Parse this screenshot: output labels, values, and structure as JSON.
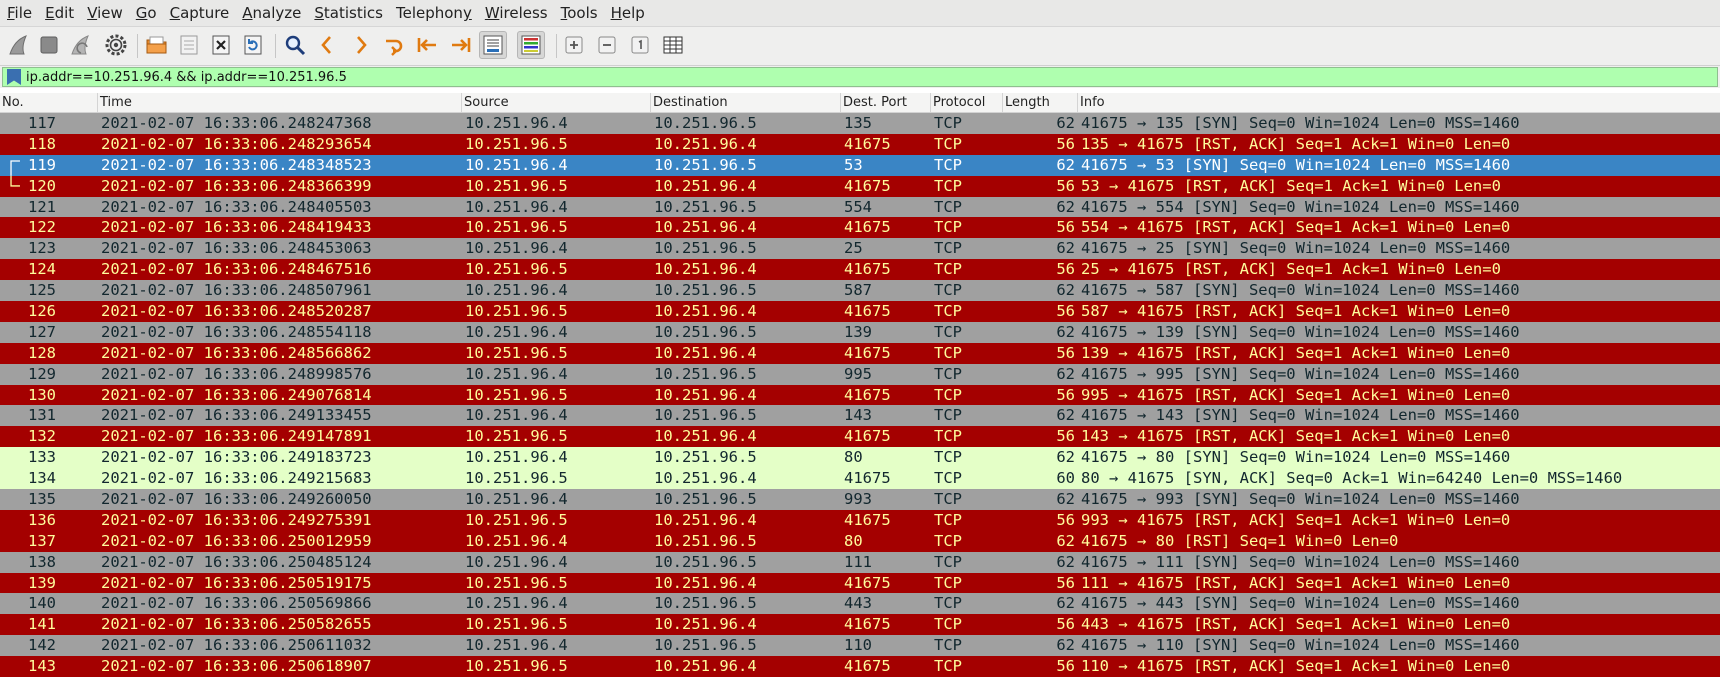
{
  "menu": {
    "items": [
      {
        "key": "F",
        "rest": "ile"
      },
      {
        "key": "E",
        "rest": "dit"
      },
      {
        "key": "V",
        "rest": "iew"
      },
      {
        "key": "G",
        "rest": "o"
      },
      {
        "key": "C",
        "rest": "apture"
      },
      {
        "key": "A",
        "rest": "nalyze"
      },
      {
        "key": "S",
        "rest": "tatistics"
      },
      {
        "key": "",
        "rest": "Telephon",
        "key2": "y"
      },
      {
        "key": "W",
        "rest": "ireless"
      },
      {
        "key": "T",
        "rest": "ools"
      },
      {
        "key": "H",
        "rest": "elp"
      }
    ]
  },
  "toolbar": {
    "icons": [
      "shark-fin-start-icon",
      "stop-square-icon",
      "shark-fin-restart-icon",
      "gear-options-icon",
      "open-folder-icon",
      "save-file-icon",
      "close-file-icon",
      "reload-icon",
      "search-magnifier-icon",
      "go-back-icon",
      "go-forward-icon",
      "go-to-packet-icon",
      "first-packet-icon",
      "last-packet-icon",
      "autoscroll-icon",
      "colorize-icon",
      "zoom-in-icon",
      "zoom-out-icon",
      "normal-size-icon",
      "resize-columns-icon"
    ]
  },
  "filter": {
    "value": "ip.addr==10.251.96.4 && ip.addr==10.251.96.5"
  },
  "columns": [
    "No.",
    "Time",
    "Source",
    "Destination",
    "Dest. Port",
    "Protocol",
    "Length",
    "Info"
  ],
  "colors": {
    "synfin_bg": "#a0a0a0",
    "rst_bg": "#a40000",
    "rst_fg": "#fffc9c",
    "selected_bg": "#3a85c5",
    "http_bg": "#e4ffc7",
    "filter_bg": "#afffaf"
  },
  "selected_row": 2,
  "packets": [
    {
      "no": "117",
      "time": "2021-02-07 16:33:06.248247368",
      "src": "10.251.96.4",
      "dst": "10.251.96.5",
      "port": "135",
      "proto": "TCP",
      "len": "62",
      "info": "41675 → 135 [SYN] Seq=0 Win=1024 Len=0 MSS=1460",
      "kind": "synfin"
    },
    {
      "no": "118",
      "time": "2021-02-07 16:33:06.248293654",
      "src": "10.251.96.5",
      "dst": "10.251.96.4",
      "port": "41675",
      "proto": "TCP",
      "len": "56",
      "info": "135 → 41675 [RST, ACK] Seq=1 Ack=1 Win=0 Len=0",
      "kind": "rst"
    },
    {
      "no": "119",
      "time": "2021-02-07 16:33:06.248348523",
      "src": "10.251.96.4",
      "dst": "10.251.96.5",
      "port": "53",
      "proto": "TCP",
      "len": "62",
      "info": "41675 → 53 [SYN] Seq=0 Win=1024 Len=0 MSS=1460",
      "kind": "sel"
    },
    {
      "no": "120",
      "time": "2021-02-07 16:33:06.248366399",
      "src": "10.251.96.5",
      "dst": "10.251.96.4",
      "port": "41675",
      "proto": "TCP",
      "len": "56",
      "info": "53 → 41675 [RST, ACK] Seq=1 Ack=1 Win=0 Len=0",
      "kind": "rst"
    },
    {
      "no": "121",
      "time": "2021-02-07 16:33:06.248405503",
      "src": "10.251.96.4",
      "dst": "10.251.96.5",
      "port": "554",
      "proto": "TCP",
      "len": "62",
      "info": "41675 → 554 [SYN] Seq=0 Win=1024 Len=0 MSS=1460",
      "kind": "synfin"
    },
    {
      "no": "122",
      "time": "2021-02-07 16:33:06.248419433",
      "src": "10.251.96.5",
      "dst": "10.251.96.4",
      "port": "41675",
      "proto": "TCP",
      "len": "56",
      "info": "554 → 41675 [RST, ACK] Seq=1 Ack=1 Win=0 Len=0",
      "kind": "rst"
    },
    {
      "no": "123",
      "time": "2021-02-07 16:33:06.248453063",
      "src": "10.251.96.4",
      "dst": "10.251.96.5",
      "port": "25",
      "proto": "TCP",
      "len": "62",
      "info": "41675 → 25 [SYN] Seq=0 Win=1024 Len=0 MSS=1460",
      "kind": "synfin"
    },
    {
      "no": "124",
      "time": "2021-02-07 16:33:06.248467516",
      "src": "10.251.96.5",
      "dst": "10.251.96.4",
      "port": "41675",
      "proto": "TCP",
      "len": "56",
      "info": "25 → 41675 [RST, ACK] Seq=1 Ack=1 Win=0 Len=0",
      "kind": "rst"
    },
    {
      "no": "125",
      "time": "2021-02-07 16:33:06.248507961",
      "src": "10.251.96.4",
      "dst": "10.251.96.5",
      "port": "587",
      "proto": "TCP",
      "len": "62",
      "info": "41675 → 587 [SYN] Seq=0 Win=1024 Len=0 MSS=1460",
      "kind": "synfin"
    },
    {
      "no": "126",
      "time": "2021-02-07 16:33:06.248520287",
      "src": "10.251.96.5",
      "dst": "10.251.96.4",
      "port": "41675",
      "proto": "TCP",
      "len": "56",
      "info": "587 → 41675 [RST, ACK] Seq=1 Ack=1 Win=0 Len=0",
      "kind": "rst"
    },
    {
      "no": "127",
      "time": "2021-02-07 16:33:06.248554118",
      "src": "10.251.96.4",
      "dst": "10.251.96.5",
      "port": "139",
      "proto": "TCP",
      "len": "62",
      "info": "41675 → 139 [SYN] Seq=0 Win=1024 Len=0 MSS=1460",
      "kind": "synfin"
    },
    {
      "no": "128",
      "time": "2021-02-07 16:33:06.248566862",
      "src": "10.251.96.5",
      "dst": "10.251.96.4",
      "port": "41675",
      "proto": "TCP",
      "len": "56",
      "info": "139 → 41675 [RST, ACK] Seq=1 Ack=1 Win=0 Len=0",
      "kind": "rst"
    },
    {
      "no": "129",
      "time": "2021-02-07 16:33:06.248998576",
      "src": "10.251.96.4",
      "dst": "10.251.96.5",
      "port": "995",
      "proto": "TCP",
      "len": "62",
      "info": "41675 → 995 [SYN] Seq=0 Win=1024 Len=0 MSS=1460",
      "kind": "synfin"
    },
    {
      "no": "130",
      "time": "2021-02-07 16:33:06.249076814",
      "src": "10.251.96.5",
      "dst": "10.251.96.4",
      "port": "41675",
      "proto": "TCP",
      "len": "56",
      "info": "995 → 41675 [RST, ACK] Seq=1 Ack=1 Win=0 Len=0",
      "kind": "rst"
    },
    {
      "no": "131",
      "time": "2021-02-07 16:33:06.249133455",
      "src": "10.251.96.4",
      "dst": "10.251.96.5",
      "port": "143",
      "proto": "TCP",
      "len": "62",
      "info": "41675 → 143 [SYN] Seq=0 Win=1024 Len=0 MSS=1460",
      "kind": "synfin"
    },
    {
      "no": "132",
      "time": "2021-02-07 16:33:06.249147891",
      "src": "10.251.96.5",
      "dst": "10.251.96.4",
      "port": "41675",
      "proto": "TCP",
      "len": "56",
      "info": "143 → 41675 [RST, ACK] Seq=1 Ack=1 Win=0 Len=0",
      "kind": "rst"
    },
    {
      "no": "133",
      "time": "2021-02-07 16:33:06.249183723",
      "src": "10.251.96.4",
      "dst": "10.251.96.5",
      "port": "80",
      "proto": "TCP",
      "len": "62",
      "info": "41675 → 80 [SYN] Seq=0 Win=1024 Len=0 MSS=1460",
      "kind": "http"
    },
    {
      "no": "134",
      "time": "2021-02-07 16:33:06.249215683",
      "src": "10.251.96.5",
      "dst": "10.251.96.4",
      "port": "41675",
      "proto": "TCP",
      "len": "60",
      "info": "80 → 41675 [SYN, ACK] Seq=0 Ack=1 Win=64240 Len=0 MSS=1460",
      "kind": "http"
    },
    {
      "no": "135",
      "time": "2021-02-07 16:33:06.249260050",
      "src": "10.251.96.4",
      "dst": "10.251.96.5",
      "port": "993",
      "proto": "TCP",
      "len": "62",
      "info": "41675 → 993 [SYN] Seq=0 Win=1024 Len=0 MSS=1460",
      "kind": "synfin"
    },
    {
      "no": "136",
      "time": "2021-02-07 16:33:06.249275391",
      "src": "10.251.96.5",
      "dst": "10.251.96.4",
      "port": "41675",
      "proto": "TCP",
      "len": "56",
      "info": "993 → 41675 [RST, ACK] Seq=1 Ack=1 Win=0 Len=0",
      "kind": "rst"
    },
    {
      "no": "137",
      "time": "2021-02-07 16:33:06.250012959",
      "src": "10.251.96.4",
      "dst": "10.251.96.5",
      "port": "80",
      "proto": "TCP",
      "len": "62",
      "info": "41675 → 80 [RST] Seq=1 Win=0 Len=0",
      "kind": "rst"
    },
    {
      "no": "138",
      "time": "2021-02-07 16:33:06.250485124",
      "src": "10.251.96.4",
      "dst": "10.251.96.5",
      "port": "111",
      "proto": "TCP",
      "len": "62",
      "info": "41675 → 111 [SYN] Seq=0 Win=1024 Len=0 MSS=1460",
      "kind": "synfin"
    },
    {
      "no": "139",
      "time": "2021-02-07 16:33:06.250519175",
      "src": "10.251.96.5",
      "dst": "10.251.96.4",
      "port": "41675",
      "proto": "TCP",
      "len": "56",
      "info": "111 → 41675 [RST, ACK] Seq=1 Ack=1 Win=0 Len=0",
      "kind": "rst"
    },
    {
      "no": "140",
      "time": "2021-02-07 16:33:06.250569866",
      "src": "10.251.96.4",
      "dst": "10.251.96.5",
      "port": "443",
      "proto": "TCP",
      "len": "62",
      "info": "41675 → 443 [SYN] Seq=0 Win=1024 Len=0 MSS=1460",
      "kind": "synfin"
    },
    {
      "no": "141",
      "time": "2021-02-07 16:33:06.250582655",
      "src": "10.251.96.5",
      "dst": "10.251.96.4",
      "port": "41675",
      "proto": "TCP",
      "len": "56",
      "info": "443 → 41675 [RST, ACK] Seq=1 Ack=1 Win=0 Len=0",
      "kind": "rst"
    },
    {
      "no": "142",
      "time": "2021-02-07 16:33:06.250611032",
      "src": "10.251.96.4",
      "dst": "10.251.96.5",
      "port": "110",
      "proto": "TCP",
      "len": "62",
      "info": "41675 → 110 [SYN] Seq=0 Win=1024 Len=0 MSS=1460",
      "kind": "synfin"
    },
    {
      "no": "143",
      "time": "2021-02-07 16:33:06.250618907",
      "src": "10.251.96.5",
      "dst": "10.251.96.4",
      "port": "41675",
      "proto": "TCP",
      "len": "56",
      "info": "110 → 41675 [RST, ACK] Seq=1 Ack=1 Win=0 Len=0",
      "kind": "rst"
    }
  ]
}
